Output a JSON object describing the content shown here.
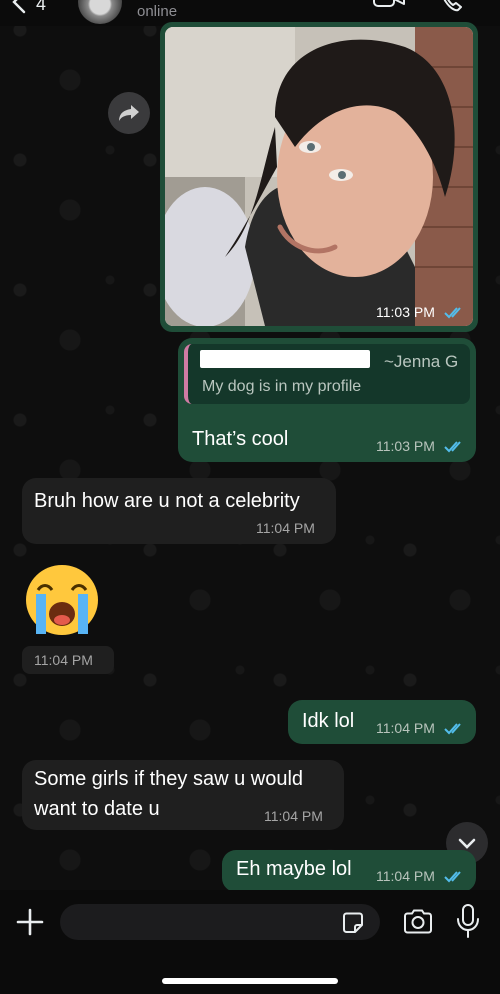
{
  "header": {
    "back_count": "4",
    "status": "online"
  },
  "messages": [
    {
      "type": "image",
      "time": "11:03 PM"
    },
    {
      "type": "reply",
      "quote_author": "~Jenna G",
      "quote_text": "My dog is in my profile",
      "text": "That’s cool",
      "time": "11:03 PM"
    },
    {
      "type": "in",
      "text": "Bruh how are u not a celebrity",
      "time": "11:04 PM"
    },
    {
      "type": "emoji",
      "emoji": "loudly-crying-face",
      "time": "11:04 PM"
    },
    {
      "type": "out",
      "text": "Idk lol",
      "time": "11:04 PM"
    },
    {
      "type": "in",
      "text_line1": "Some girls if they saw u would",
      "text_line2": "want to date u",
      "time": "11:04 PM"
    },
    {
      "type": "out",
      "text": "Eh maybe lol",
      "time": "11:04 PM"
    }
  ],
  "input": {
    "placeholder": ""
  },
  "icons": [
    "back-icon",
    "video-call-icon",
    "phone-icon",
    "forward-icon",
    "chevron-down-icon",
    "plus-icon",
    "sticker-icon",
    "camera-icon",
    "microphone-icon"
  ],
  "colors": {
    "outgoing": "#1f4d38",
    "incoming": "#1f1f1f",
    "read_ticks": "#53bdeb"
  }
}
